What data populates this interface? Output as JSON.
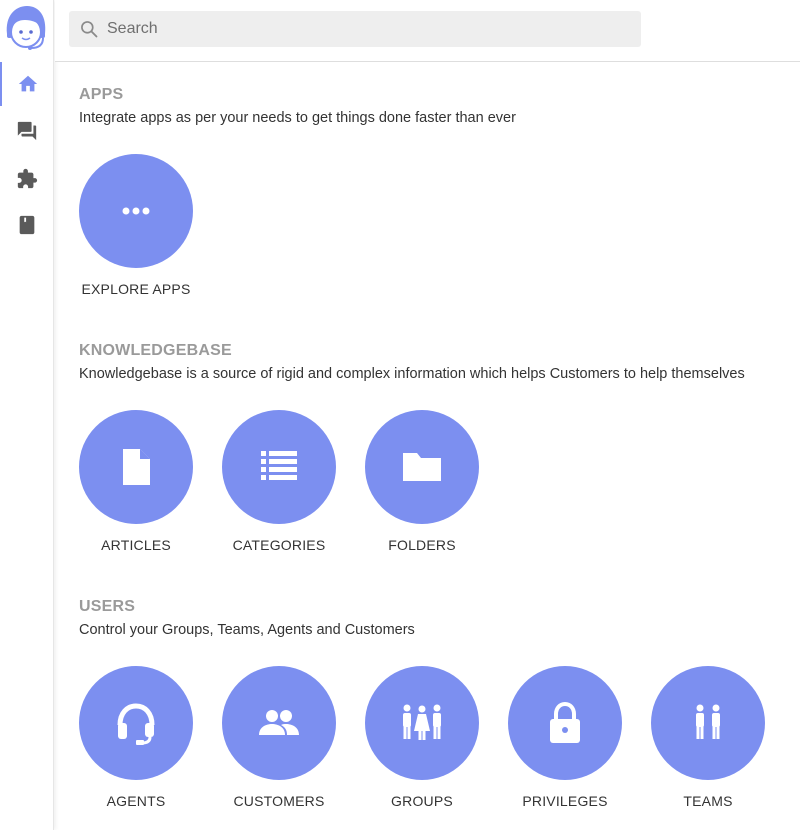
{
  "colors": {
    "accent": "#7c8ff0",
    "sidebar_icon": "#5a5a5a",
    "section_title": "#9a9a9a"
  },
  "sidebar": {
    "logo": "support-agent-avatar-logo",
    "items": [
      {
        "icon": "home-icon",
        "active": true
      },
      {
        "icon": "chat-icon",
        "active": false
      },
      {
        "icon": "puzzle-icon",
        "active": false
      },
      {
        "icon": "bookmark-book-icon",
        "active": false
      }
    ]
  },
  "search": {
    "placeholder": "Search",
    "value": ""
  },
  "sections": {
    "apps": {
      "title": "APPS",
      "description": "Integrate apps as per your needs to get things done faster than ever",
      "tiles": [
        {
          "label": "EXPLORE APPS",
          "icon": "more-dots-icon"
        }
      ]
    },
    "knowledgebase": {
      "title": "KNOWLEDGEBASE",
      "description": "Knowledgebase is a source of rigid and complex information which helps Customers to help themselves",
      "tiles": [
        {
          "label": "ARTICLES",
          "icon": "document-icon"
        },
        {
          "label": "CATEGORIES",
          "icon": "list-icon"
        },
        {
          "label": "FOLDERS",
          "icon": "folder-icon"
        }
      ]
    },
    "users": {
      "title": "USERS",
      "description": "Control your Groups, Teams, Agents and Customers",
      "tiles": [
        {
          "label": "AGENTS",
          "icon": "headset-icon"
        },
        {
          "label": "CUSTOMERS",
          "icon": "people-icon"
        },
        {
          "label": "GROUPS",
          "icon": "group-icon"
        },
        {
          "label": "PRIVILEGES",
          "icon": "lock-icon"
        },
        {
          "label": "TEAMS",
          "icon": "team-icon"
        }
      ]
    }
  }
}
